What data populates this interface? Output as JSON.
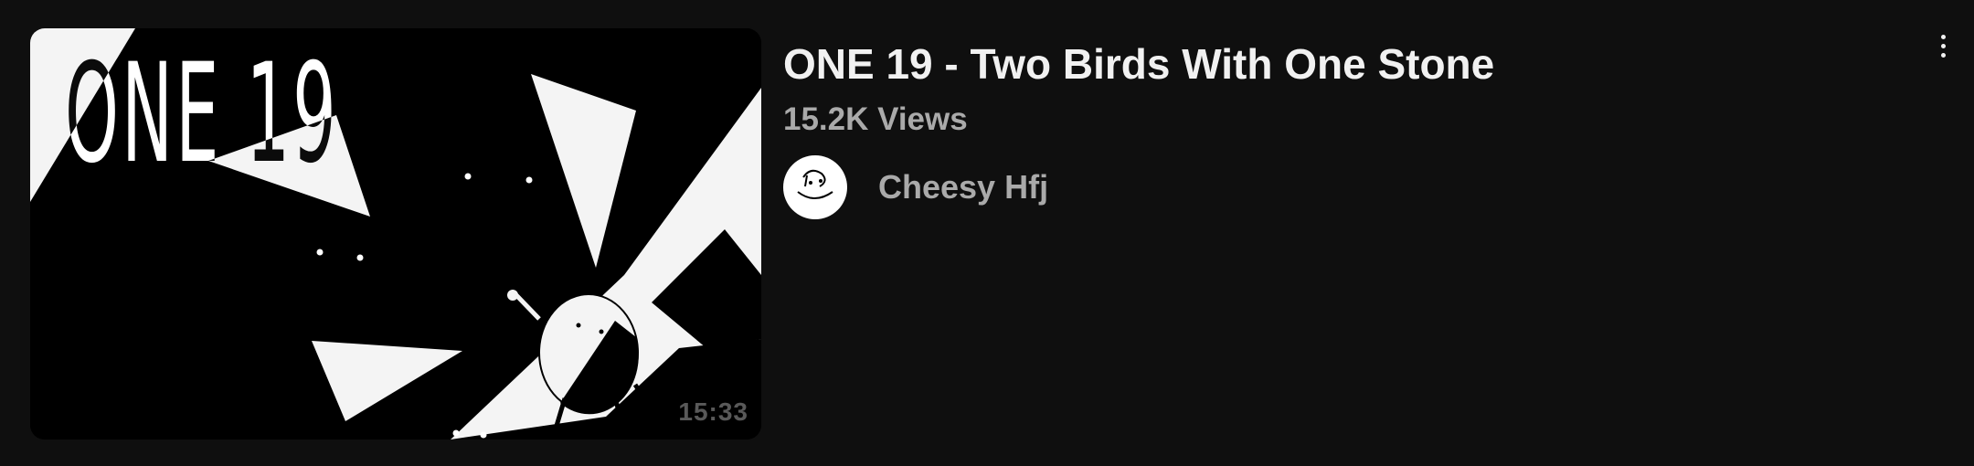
{
  "video": {
    "title": "ONE 19 - Two Birds With One Stone",
    "views": "15.2K Views",
    "channel": "Cheesy Hfj",
    "duration": "15:33",
    "thumbnail_text": "ONE 19"
  },
  "icons": {
    "more": "more-vert-icon",
    "avatar": "channel-avatar-doodle"
  },
  "colors": {
    "background": "#0f0f0f",
    "title": "#f1f1f1",
    "secondary_text": "#aaaaaa"
  }
}
